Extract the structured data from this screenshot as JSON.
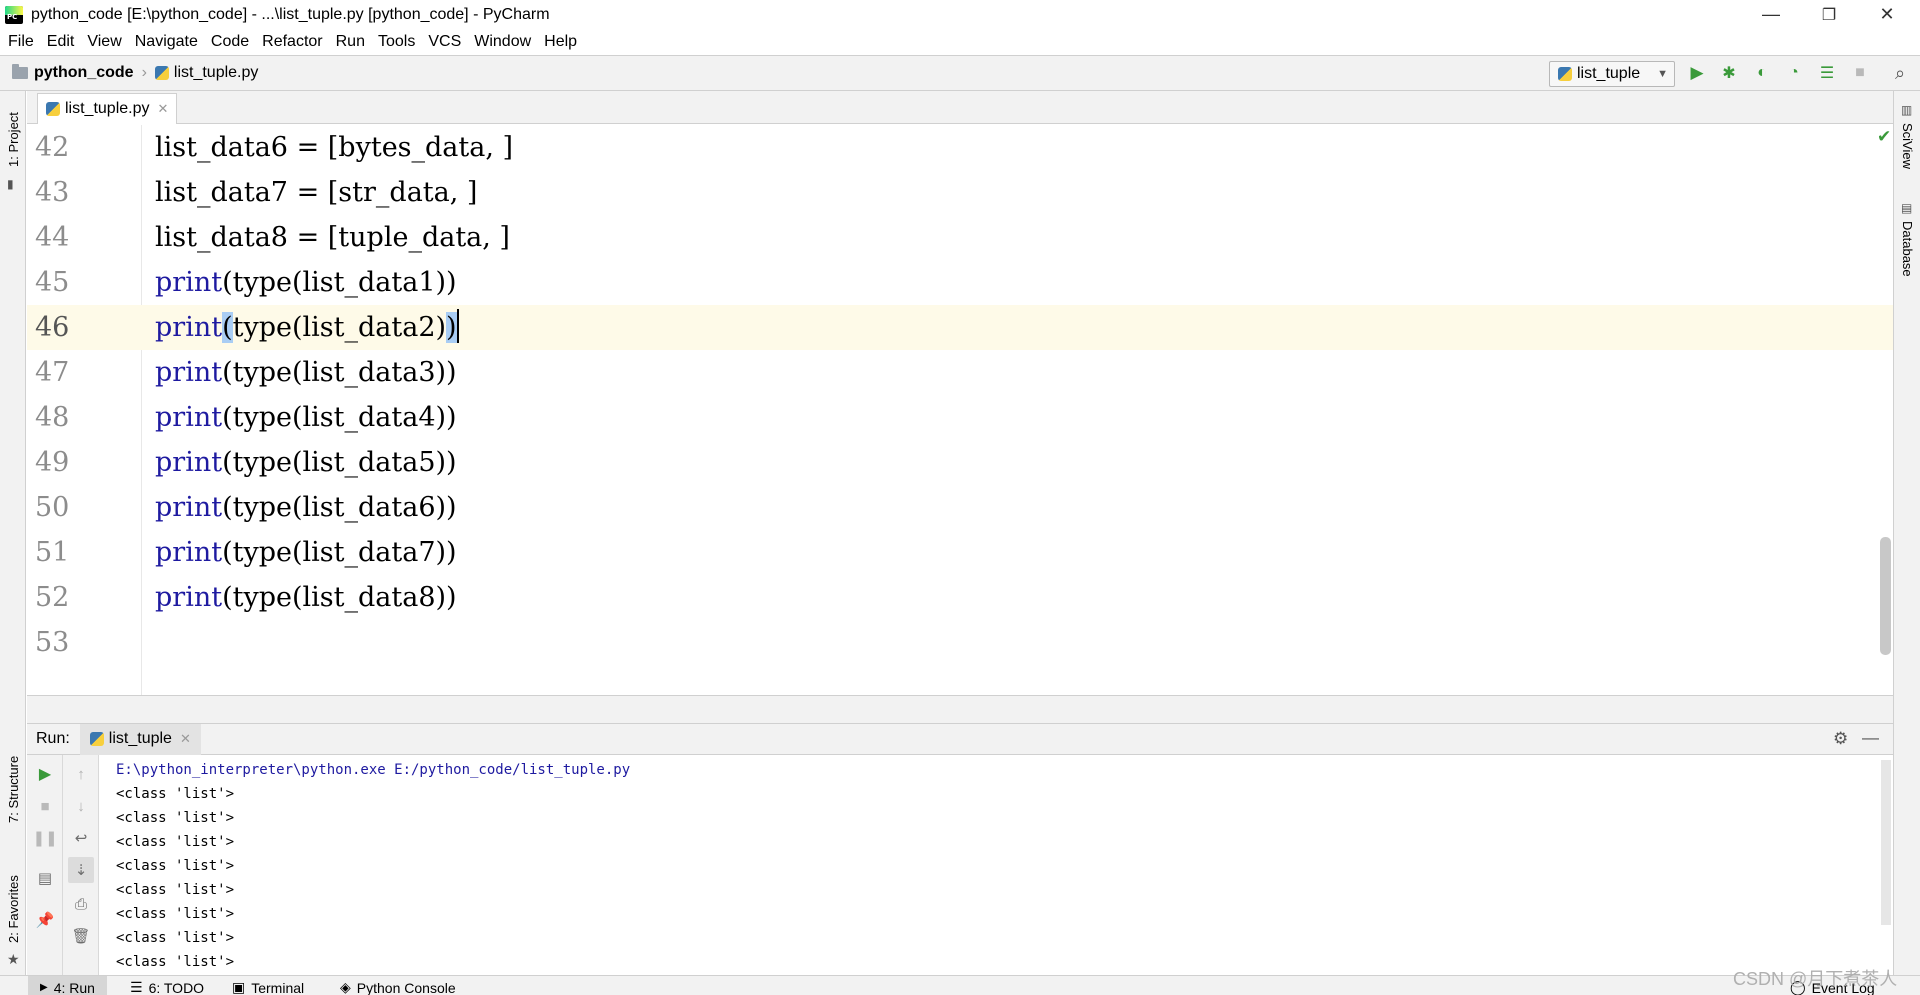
{
  "window": {
    "title": "python_code [E:\\python_code] - ...\\list_tuple.py [python_code] - PyCharm",
    "minimize": "—",
    "restore": "❐",
    "close": "✕"
  },
  "menu": [
    "File",
    "Edit",
    "View",
    "Navigate",
    "Code",
    "Refactor",
    "Run",
    "Tools",
    "VCS",
    "Window",
    "Help"
  ],
  "navbar": {
    "project": "python_code",
    "file": "list_tuple.py",
    "run_config": "list_tuple"
  },
  "left_tools": {
    "project": "1: Project",
    "structure": "7: Structure",
    "favorites": "2: Favorites"
  },
  "right_tools": {
    "sciview": "SciView",
    "database": "Database"
  },
  "editor": {
    "tab": "list_tuple.py",
    "lines": [
      {
        "num": "42",
        "text": "list_data6 = [bytes_data, ]"
      },
      {
        "num": "43",
        "text": "list_data7 = [str_data, ]"
      },
      {
        "num": "44",
        "text": "list_data8 = [tuple_data, ]"
      },
      {
        "num": "45",
        "kw": "print",
        "rest": "(type(list_data1))"
      },
      {
        "num": "46",
        "kw": "print",
        "rest": "(type(list_data2))"
      },
      {
        "num": "47",
        "kw": "print",
        "rest": "(type(list_data3))"
      },
      {
        "num": "48",
        "kw": "print",
        "rest": "(type(list_data4))"
      },
      {
        "num": "49",
        "kw": "print",
        "rest": "(type(list_data5))"
      },
      {
        "num": "50",
        "kw": "print",
        "rest": "(type(list_data6))"
      },
      {
        "num": "51",
        "kw": "print",
        "rest": "(type(list_data7))"
      },
      {
        "num": "52",
        "kw": "print",
        "rest": "(type(list_data8))"
      },
      {
        "num": "53",
        "text": ""
      }
    ],
    "current_line": "46",
    "line46": {
      "a": "print",
      "b": "(",
      "c": "type(list_data2)",
      "d": ")"
    }
  },
  "run_panel": {
    "label": "Run:",
    "tab": "list_tuple",
    "command": "E:\\python_interpreter\\python.exe E:/python_code/list_tuple.py",
    "output": [
      "<class 'list'>",
      "<class 'list'>",
      "<class 'list'>",
      "<class 'list'>",
      "<class 'list'>",
      "<class 'list'>",
      "<class 'list'>",
      "<class 'list'>"
    ]
  },
  "status_tabs": [
    "4: Run",
    "6: TODO",
    "Terminal",
    "Python Console",
    "Event Log"
  ],
  "watermark": "CSDN @月下煮茶人",
  "colors": {
    "keyword": "#1e1aa0",
    "current_line": "#fefae8",
    "selection": "#a9cdf4",
    "run_green": "#3a9a3a"
  }
}
